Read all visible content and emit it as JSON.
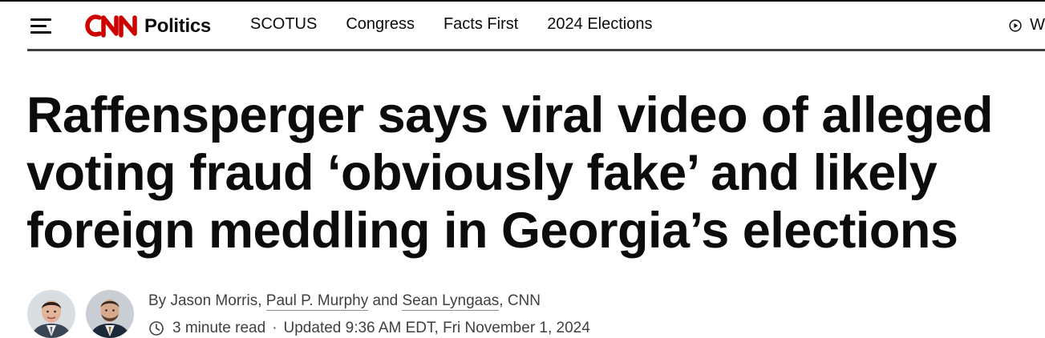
{
  "header": {
    "menu_icon": "hamburger-menu-icon",
    "logo_text": "CNN",
    "section_name": "Politics",
    "nav_items": [
      {
        "label": "SCOTUS"
      },
      {
        "label": "Congress"
      },
      {
        "label": "Facts First"
      },
      {
        "label": "2024 Elections"
      }
    ],
    "watch_icon": "play-circle-icon",
    "watch_label": "W",
    "brand_color": "#cc0000"
  },
  "article": {
    "headline": "Raffensperger says viral video of alleged voting fraud ‘obviously fake’ and likely foreign meddling in Georgia’s elections",
    "byline": {
      "prefix": "By Jason Morris, ",
      "author_2": "Paul P. Murphy",
      "middle": " and ",
      "author_3": "Sean Lyngaas",
      "suffix": ", CNN"
    },
    "meta": {
      "clock_icon": "clock-icon",
      "read_time": "3 minute read",
      "separator": "·",
      "updated": "Updated 9:36 AM EDT, Fri November 1, 2024"
    },
    "avatars": [
      {
        "name": "Paul P. Murphy avatar"
      },
      {
        "name": "Sean Lyngaas avatar"
      }
    ]
  }
}
